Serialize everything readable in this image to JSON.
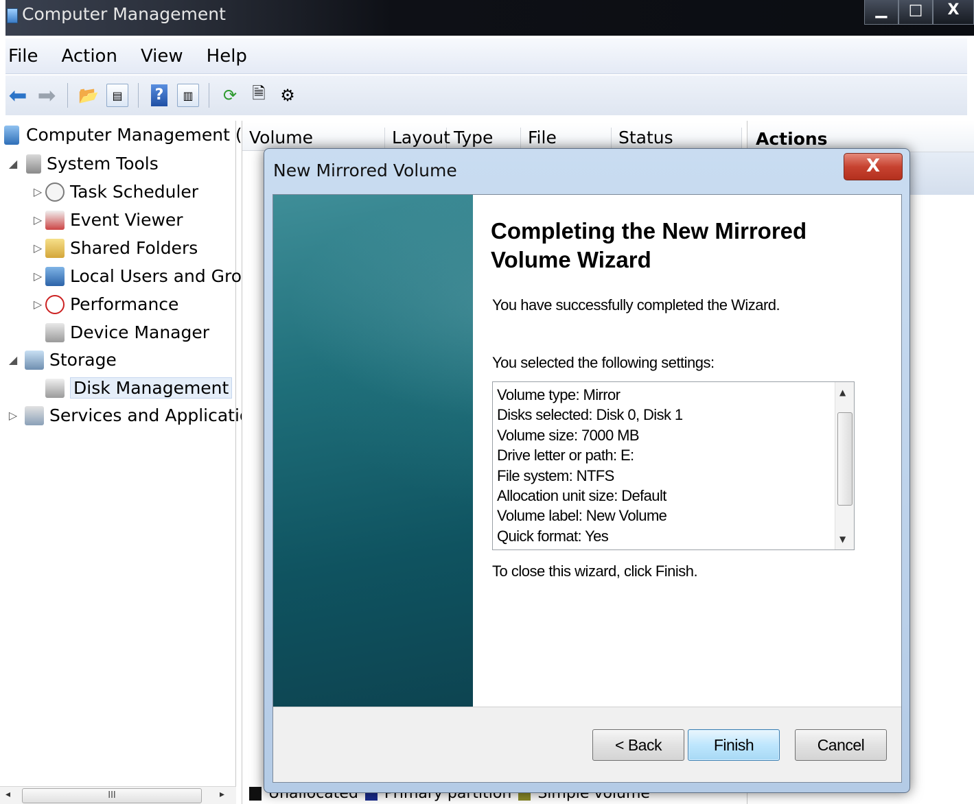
{
  "window": {
    "title": "Computer Management",
    "controls": [
      "▁",
      "□",
      "X"
    ]
  },
  "menu": [
    "File",
    "Action",
    "View",
    "Help"
  ],
  "tree": {
    "root": "Computer Management (Local",
    "system_tools": "System Tools",
    "task_scheduler": "Task Scheduler",
    "event_viewer": "Event Viewer",
    "shared_folders": "Shared Folders",
    "local_users": "Local Users and Groups",
    "performance": "Performance",
    "device_manager": "Device Manager",
    "storage": "Storage",
    "disk_management": "Disk Management",
    "services": "Services and Applications"
  },
  "list": {
    "columns": [
      "Volume",
      "Layout",
      "Type",
      "File System",
      "Status"
    ],
    "legend": [
      "Unallocated",
      "Primary partition",
      "Simple volume"
    ],
    "legend_colors": [
      "#111111",
      "#1a2c8e",
      "#8a8a2a"
    ]
  },
  "actions": {
    "header": "Actions"
  },
  "dialog": {
    "title": "New Mirrored Volume",
    "close": "X",
    "heading_line1": "Completing the New Mirrored",
    "heading_line2": "Volume Wizard",
    "success_text": "You have successfully completed the Wizard.",
    "settings_intro": "You selected the following settings:",
    "settings": [
      "Volume type: Mirror",
      "Disks selected: Disk 0, Disk 1",
      "Volume size: 7000 MB",
      "Drive letter or path: E:",
      "File system: NTFS",
      "Allocation unit size: Default",
      "Volume label: New Volume",
      "Quick format: Yes"
    ],
    "close_hint": "To close this wizard, click Finish.",
    "buttons": {
      "back": "< Back",
      "finish": "Finish",
      "cancel": "Cancel"
    }
  }
}
